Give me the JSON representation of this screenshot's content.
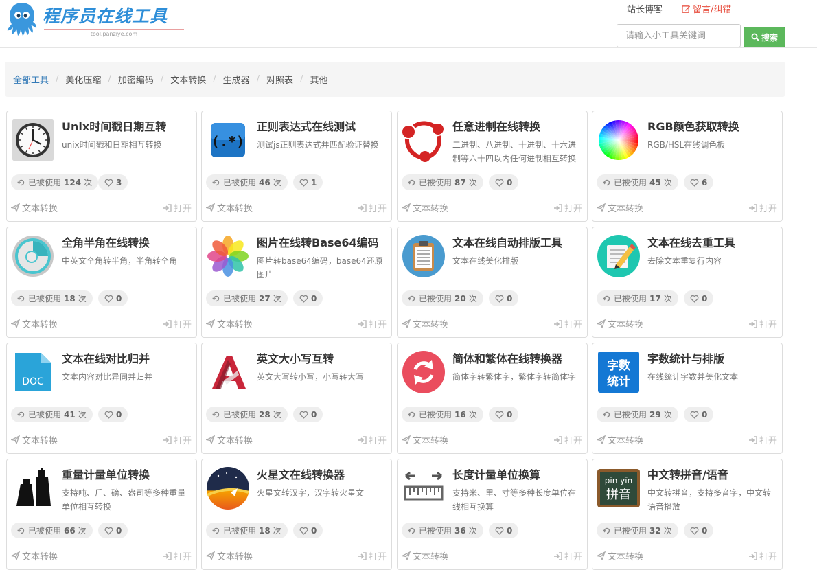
{
  "header": {
    "logo_title": "程序员在线工具",
    "logo_subtitle": "tool.panziye.com",
    "blog_link": "站长博客",
    "message_link": "留言/纠错",
    "search_placeholder": "请输入小工具关键词",
    "search_button": "搜索"
  },
  "breadcrumb": [
    "全部工具",
    "美化压缩",
    "加密编码",
    "文本转换",
    "生成器",
    "对照表",
    "其他"
  ],
  "card_labels": {
    "used_prefix": "已被使用",
    "used_suffix": "次",
    "open": "打开"
  },
  "cards": [
    {
      "title": "Unix时间戳日期互转",
      "desc": "unix时间戳和日期相互转换",
      "uses": "124",
      "likes": "3",
      "category": "文本转换",
      "icon": "clock-icon"
    },
    {
      "title": "正则表达式在线测试",
      "desc": "测试js正则表达式并匹配验证替换",
      "uses": "46",
      "likes": "1",
      "category": "文本转换",
      "icon": "regex-icon"
    },
    {
      "title": "任意进制在线转换",
      "desc": "二进制、八进制、十进制、十六进制等六十四以内任何进制相互转换",
      "uses": "87",
      "likes": "0",
      "category": "文本转换",
      "icon": "network-icon"
    },
    {
      "title": "RGB颜色获取转换",
      "desc": "RGB/HSL在线调色板",
      "uses": "45",
      "likes": "6",
      "category": "文本转换",
      "icon": "color-wheel-icon"
    },
    {
      "title": "全角半角在线转换",
      "desc": "中英文全角转半角，半角转全角",
      "uses": "18",
      "likes": "0",
      "category": "文本转换",
      "icon": "toggle-circle-icon"
    },
    {
      "title": "图片在线转Base64编码",
      "desc": "图片转base64编码，base64还原图片",
      "uses": "27",
      "likes": "0",
      "category": "文本转换",
      "icon": "photos-flower-icon"
    },
    {
      "title": "文本在线自动排版工具",
      "desc": "文本在线美化排版",
      "uses": "20",
      "likes": "0",
      "category": "文本转换",
      "icon": "clipboard-icon"
    },
    {
      "title": "文本在线去重工具",
      "desc": "去除文本重复行内容",
      "uses": "17",
      "likes": "0",
      "category": "文本转换",
      "icon": "pencil-note-icon"
    },
    {
      "title": "文本在线对比归并",
      "desc": "文本内容对比异同并归并",
      "uses": "41",
      "likes": "0",
      "category": "文本转换",
      "icon": "doc-file-icon",
      "icon_text": "DOC"
    },
    {
      "title": "英文大小写互转",
      "desc": "英文大写转小写，小写转大写",
      "uses": "28",
      "likes": "0",
      "category": "文本转换",
      "icon": "letter-a-icon"
    },
    {
      "title": "简体和繁体在线转换器",
      "desc": "简体字转繁体字，繁体字转简体字",
      "uses": "16",
      "likes": "0",
      "category": "文本转换",
      "icon": "refresh-circle-icon"
    },
    {
      "title": "字数统计与排版",
      "desc": "在线统计字数并美化文本",
      "uses": "29",
      "likes": "0",
      "category": "文本转换",
      "icon": "word-count-icon",
      "icon_text": "字数统计"
    },
    {
      "title": "重量计量单位转换",
      "desc": "支持吨、斤、磅、盎司等多种重量单位相互转换",
      "uses": "66",
      "likes": "0",
      "category": "文本转换",
      "icon": "weights-icon"
    },
    {
      "title": "火星文在线转换器",
      "desc": "火星文转汉字，汉字转火星文",
      "uses": "18",
      "likes": "0",
      "category": "文本转换",
      "icon": "rocket-night-icon"
    },
    {
      "title": "长度计量单位换算",
      "desc": "支持米、里、寸等多种长度单位在线相互换算",
      "uses": "36",
      "likes": "0",
      "category": "文本转换",
      "icon": "ruler-icon"
    },
    {
      "title": "中文转拼音/语音",
      "desc": "中文转拼音，支持多音字，中文转语音播放",
      "uses": "32",
      "likes": "0",
      "category": "文本转换",
      "icon": "blackboard-pinyin-icon",
      "icon_text_top": "pīn yīn",
      "icon_text_bottom": "拼音"
    }
  ]
}
